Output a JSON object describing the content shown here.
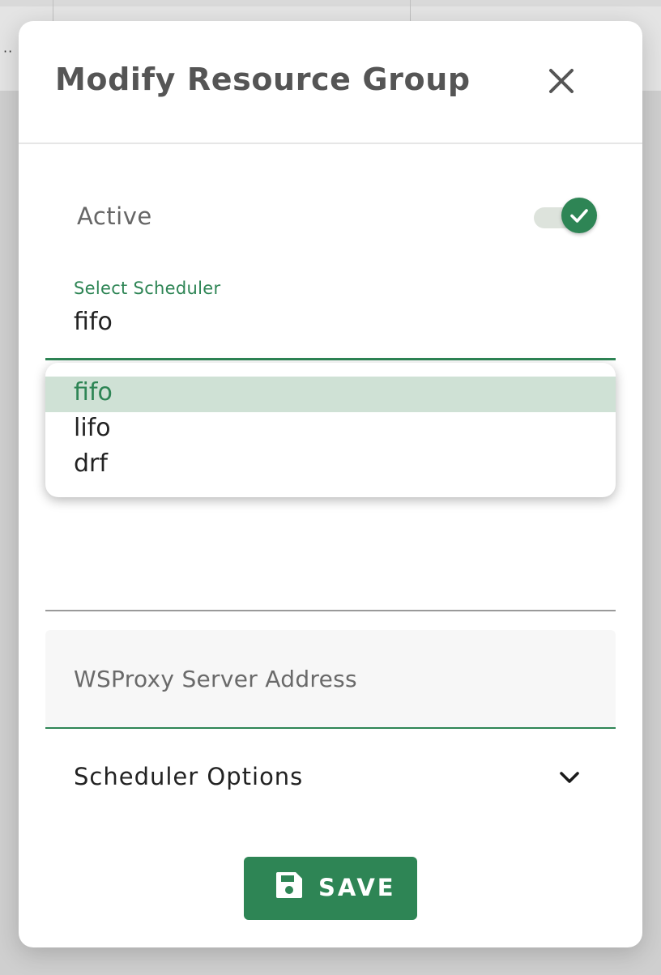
{
  "dialog": {
    "title": "Modify Resource Group",
    "close_icon": "close-icon"
  },
  "active": {
    "label": "Active",
    "checked": true,
    "icon": "check-icon"
  },
  "scheduler": {
    "label": "Select Scheduler",
    "value": "fifo",
    "options": [
      "fifo",
      "lifo",
      "drf"
    ],
    "selected_index": 0
  },
  "wsproxy": {
    "placeholder": "WSProxy Server Address",
    "value": ""
  },
  "scheduler_options": {
    "label": "Scheduler Options",
    "icon": "chevron-down-icon"
  },
  "save_button": {
    "label": "SAVE",
    "icon": "save-icon"
  },
  "colors": {
    "accent": "#2e8555",
    "selected_bg": "#cfe1d5"
  }
}
